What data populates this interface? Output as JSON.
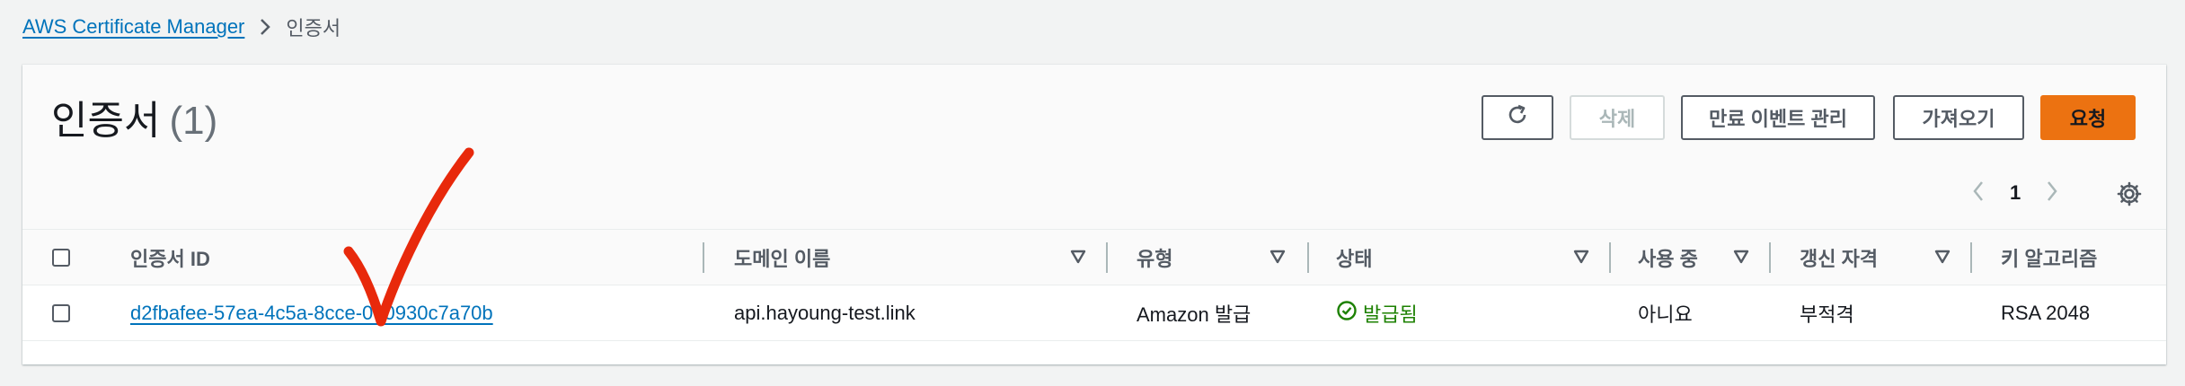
{
  "breadcrumb": {
    "root": "AWS Certificate Manager",
    "current": "인증서"
  },
  "panel": {
    "title": "인증서",
    "count": "(1)"
  },
  "toolbar": {
    "delete_label": "삭제",
    "expiry_events_label": "만료 이벤트 관리",
    "import_label": "가져오기",
    "request_label": "요청"
  },
  "pagination": {
    "current_page": "1"
  },
  "table": {
    "columns": [
      "인증서 ID",
      "도메인 이름",
      "유형",
      "상태",
      "사용 중",
      "갱신 자격",
      "키 알고리즘"
    ],
    "rows": [
      {
        "certificate_id": "d2fbafee-57ea-4c5a-8cce-090930c7a70b",
        "domain_name": "api.hayoung-test.link",
        "type": "Amazon 발급",
        "status": "발급됨",
        "in_use": "아니요",
        "renewal_eligibility": "부적격",
        "key_algorithm": "RSA 2048"
      }
    ]
  },
  "colors": {
    "link": "#0073bb",
    "primary_button": "#ec7211",
    "status_success": "#1d8102",
    "annotation": "#e8290b"
  }
}
